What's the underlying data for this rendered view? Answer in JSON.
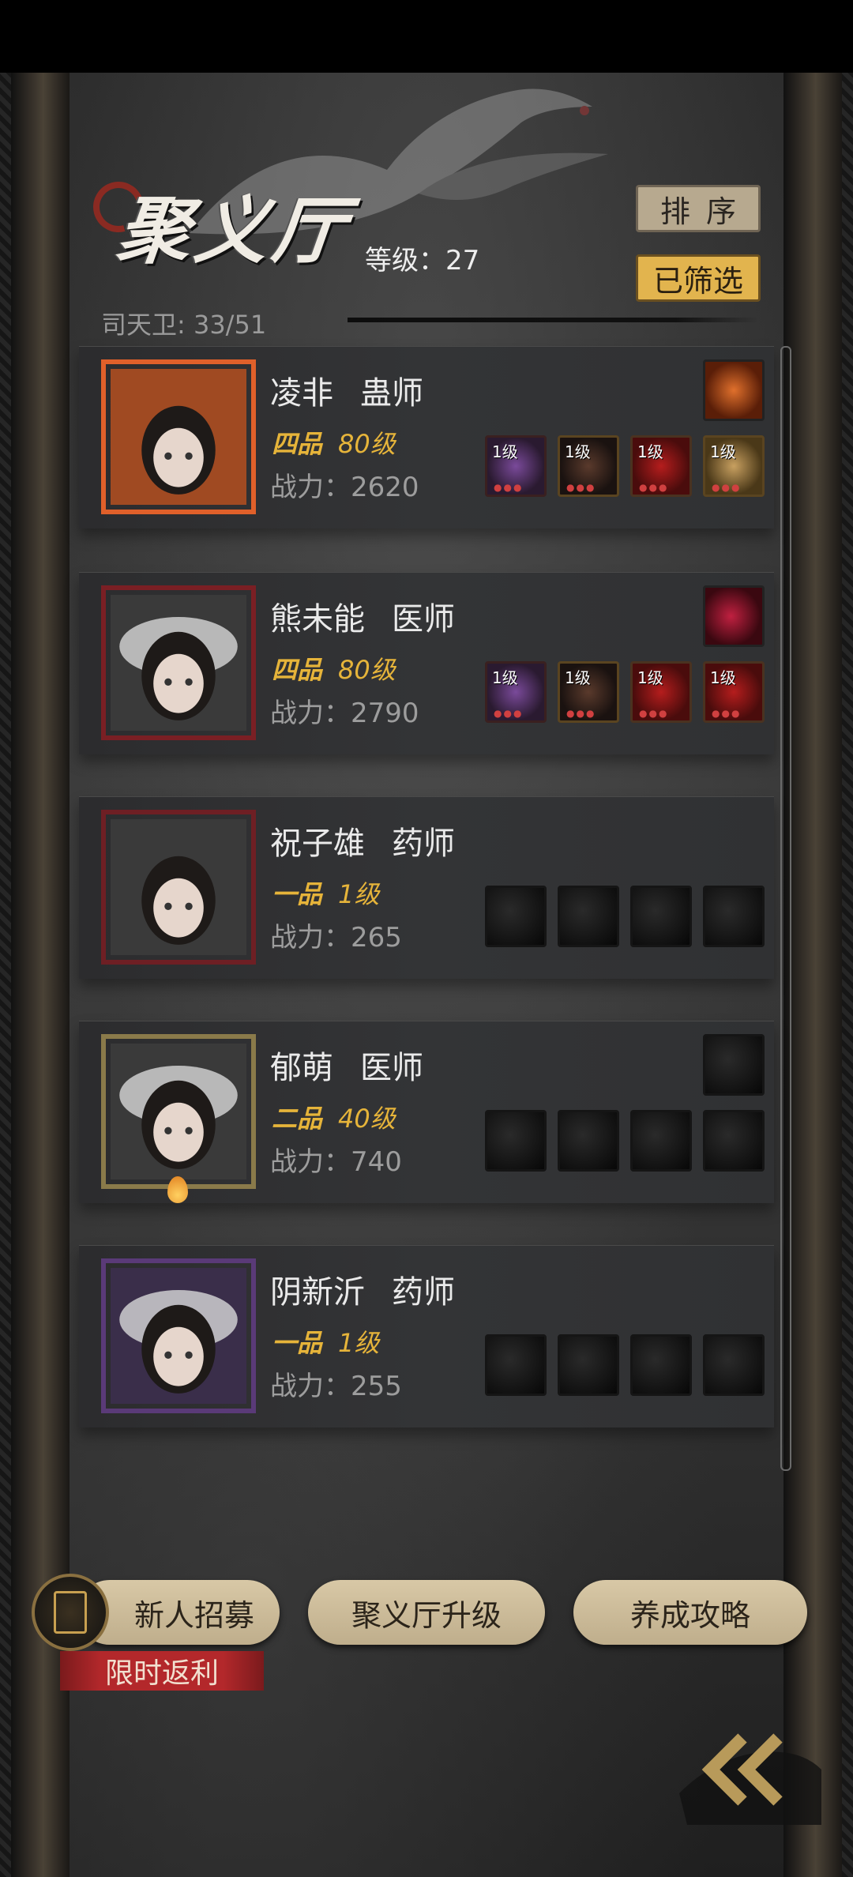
{
  "header": {
    "title": "聚义厅",
    "level_text": "等级：27",
    "guard_text": "司天卫: 33/51",
    "sort_label": "排序",
    "filter_label": "已筛选"
  },
  "characters": [
    {
      "name": "凌非",
      "job": "蛊师",
      "rank": "四品",
      "level": "80级",
      "power": "战力：2620",
      "frame_color": "#e0602a",
      "gem": "gem-amber",
      "equipment": [
        {
          "tag": "1级",
          "style": "eq-purple"
        },
        {
          "tag": "1级",
          "style": "eq-dark"
        },
        {
          "tag": "1级",
          "style": "eq-red"
        },
        {
          "tag": "1级",
          "style": "eq-gold"
        }
      ]
    },
    {
      "name": "熊未能",
      "job": "医师",
      "rank": "四品",
      "level": "80级",
      "power": "战力：2790",
      "frame_color": "#7a1f24",
      "gem": "gem-red",
      "equipment": [
        {
          "tag": "1级",
          "style": "eq-purple"
        },
        {
          "tag": "1级",
          "style": "eq-dark"
        },
        {
          "tag": "1级",
          "style": "eq-red"
        },
        {
          "tag": "1级",
          "style": "eq-red"
        }
      ]
    },
    {
      "name": "祝子雄",
      "job": "药师",
      "rank": "一品",
      "level": "1级",
      "power": "战力：265",
      "frame_color": "#6e1f24",
      "gem": null,
      "equipment": [
        {
          "tag": ""
        },
        {
          "tag": ""
        },
        {
          "tag": ""
        },
        {
          "tag": ""
        }
      ]
    },
    {
      "name": "郁萌",
      "job": "医师",
      "rank": "二品",
      "level": "40级",
      "power": "战力：740",
      "frame_color": "#8a7a4a",
      "gem": "empty",
      "equipment": [
        {
          "tag": ""
        },
        {
          "tag": ""
        },
        {
          "tag": ""
        },
        {
          "tag": ""
        }
      ]
    },
    {
      "name": "阴新沂",
      "job": "药师",
      "rank": "一品",
      "level": "1级",
      "power": "战力：255",
      "frame_color": "#5a3a78",
      "gem": null,
      "equipment": [
        {
          "tag": ""
        },
        {
          "tag": ""
        },
        {
          "tag": ""
        },
        {
          "tag": ""
        }
      ]
    }
  ],
  "bottom": {
    "recruit_label": "新人招募",
    "upgrade_label": "聚义厅升级",
    "guide_label": "养成攻略",
    "promo_label": "限时返利"
  }
}
